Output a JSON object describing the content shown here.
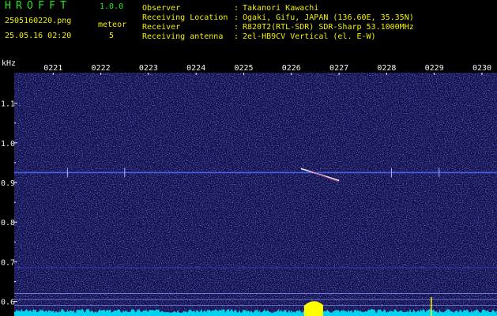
{
  "header": {
    "app_name": "HROFFT",
    "version": "1.0.0",
    "file_name": "2505160220.png",
    "timestamp": "25.05.16 02:20",
    "meteor_label": "meteor",
    "meteor_count": "5",
    "info": [
      {
        "label": "Observer",
        "sep": ":",
        "value": "Takanori Kawachi"
      },
      {
        "label": "Receiving Location",
        "sep": ":",
        "value": "Ogaki, Gifu, JAPAN (136.60E, 35.35N)"
      },
      {
        "label": "Receiver",
        "sep": ":",
        "value": "R820T2(RTL-SDR) SDR-Sharp 53.1000MHz"
      },
      {
        "label": "Receiving antenna",
        "sep": ":",
        "value": "2el-HB9CV Vertical (el. E-W)"
      }
    ]
  },
  "chart_data": {
    "type": "heatmap",
    "ylabel": "kHz",
    "x_ticks": [
      "0221",
      "0222",
      "0223",
      "0224",
      "0225",
      "0226",
      "0227",
      "0228",
      "0229",
      "0230"
    ],
    "y_ticks": [
      "1.1",
      "1.0",
      "0.9",
      "0.8",
      "0.7",
      "0.6"
    ],
    "ylim": [
      0.6,
      1.15
    ],
    "xlim": [
      "02:20",
      "02:30"
    ],
    "carrier_khz": 0.925,
    "horizontal_lines_khz": [
      0.685,
      0.62,
      0.605,
      0.59
    ],
    "meteor_echo": {
      "start_time": "02:26.2",
      "end_time": "02:27.0",
      "start_khz": 0.935,
      "end_khz": 0.905
    },
    "short_pings": [
      {
        "time": "02:21.3"
      },
      {
        "time": "02:22.5"
      },
      {
        "time": "02:28.1"
      },
      {
        "time": "02:29.1"
      }
    ],
    "colors": {
      "background": "#10104a",
      "noise": "#2a2ab0",
      "carrier": "#5566ff",
      "echo": "#ffffff",
      "spectrum": "#00e6ff",
      "spectrum_peak": "#ffff00",
      "tick": "#f4f4f4",
      "header_green": "#22e622",
      "header_yellow": "#f0f000"
    }
  }
}
